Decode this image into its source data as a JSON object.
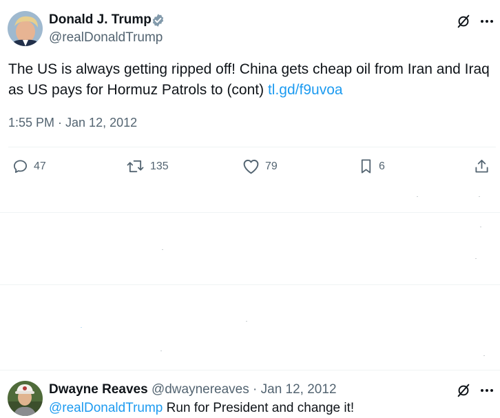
{
  "tweet": {
    "author_name": "Donald J. Trump",
    "author_handle": "@realDonaldTrump",
    "text_before_link": "The US is always getting ripped off! China gets cheap oil from Iran and Iraq as US pays for Hormuz Patrols to (cont) ",
    "link_text": "tl.gd/f9uvoa",
    "timestamp": "1:55 PM · Jan 12, 2012",
    "verified_icon": "verified-badge-icon",
    "actions": {
      "replies": "47",
      "retweets": "135",
      "likes": "79",
      "bookmarks": "6"
    }
  },
  "reply": {
    "author_name": "Dwayne Reaves",
    "author_handle": "@dwaynereaves",
    "separator": " · ",
    "date": "Jan 12, 2012",
    "mention": "@realDonaldTrump",
    "text": " Run for President and change it!"
  },
  "colors": {
    "text": "#0f1419",
    "muted": "#536471",
    "link": "#1d9bf0",
    "verified": "#829aab",
    "divider": "#eff3f4"
  }
}
